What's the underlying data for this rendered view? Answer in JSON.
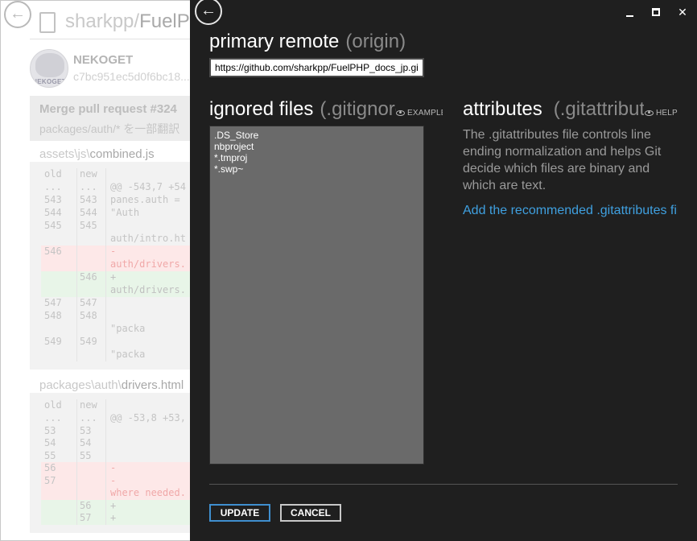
{
  "background": {
    "repo_owner": "sharkpp/",
    "repo_name": "FuelPH",
    "author": "NEKOGET",
    "avatar_tag": "NEKOGET",
    "sha": "c7bc951ec5d0f6bc18...",
    "commit_title": "Merge pull request #324",
    "commit_subtitle": "packages/auth/* を一部翻訳",
    "files": [
      {
        "dir": "assets\\js\\",
        "name": "combined.js",
        "header": [
          "old",
          "new"
        ],
        "hunk": "@@ -543,7 +54",
        "rows": [
          {
            "old": "...",
            "new": "...",
            "text": "@@ -543,7 +54",
            "kind": "hunk"
          },
          {
            "old": "543",
            "new": "543",
            "text": " panes.auth =",
            "kind": "ctx"
          },
          {
            "old": "544",
            "new": "544",
            "text": "      \"Auth",
            "kind": "ctx"
          },
          {
            "old": "545",
            "new": "545",
            "text": "",
            "kind": "ctx"
          },
          {
            "old": "",
            "new": "",
            "text": "auth/intro.ht",
            "kind": "ctx"
          },
          {
            "old": "546",
            "new": "",
            "text": "-",
            "kind": "del"
          },
          {
            "old": "",
            "new": "",
            "text": "auth/drivers.",
            "kind": "del"
          },
          {
            "old": "",
            "new": "546",
            "text": "+",
            "kind": "add"
          },
          {
            "old": "",
            "new": "",
            "text": "auth/drivers.",
            "kind": "add"
          },
          {
            "old": "547",
            "new": "547",
            "text": "",
            "kind": "ctx"
          },
          {
            "old": "548",
            "new": "548",
            "text": "",
            "kind": "ctx"
          },
          {
            "old": "",
            "new": "",
            "text": "      \"packa",
            "kind": "ctx"
          },
          {
            "old": "549",
            "new": "549",
            "text": "",
            "kind": "ctx"
          },
          {
            "old": "",
            "new": "",
            "text": "      \"packa",
            "kind": "ctx"
          }
        ]
      },
      {
        "dir": "packages\\auth\\",
        "name": "drivers.html",
        "header": [
          "old",
          "new"
        ],
        "rows": [
          {
            "old": "...",
            "new": "...",
            "text": "@@ -53,8 +53,",
            "kind": "hunk"
          },
          {
            "old": "53",
            "new": "53",
            "text": "",
            "kind": "ctx"
          },
          {
            "old": "54",
            "new": "54",
            "text": "",
            "kind": "ctx"
          },
          {
            "old": "55",
            "new": "55",
            "text": "",
            "kind": "ctx"
          },
          {
            "old": "56",
            "new": "",
            "text": "-",
            "kind": "del"
          },
          {
            "old": "57",
            "new": "",
            "text": "-",
            "kind": "del"
          },
          {
            "old": "",
            "new": "",
            "text": "where needed.",
            "kind": "del"
          },
          {
            "old": "",
            "new": "56",
            "text": "+",
            "kind": "add"
          },
          {
            "old": "",
            "new": "57",
            "text": "+",
            "kind": "add"
          }
        ]
      }
    ]
  },
  "panel": {
    "back_icon": "back-arrow-icon",
    "window_controls": {
      "minimize": "minimize-icon",
      "maximize": "maximize-icon",
      "close": "close-icon",
      "close_glyph": "✕"
    },
    "remote": {
      "title": "primary remote",
      "subtitle": "(origin)",
      "url": "https://github.com/sharkpp/FuelPHP_docs_jp.git"
    },
    "ignored": {
      "title": "ignored files",
      "subtitle": "(.gitignore)",
      "hint_label": "EXAMPLES",
      "hint_icon": "eye-icon",
      "lines": [
        ".DS_Store",
        "nbproject",
        "*.tmproj",
        "*.swp~"
      ]
    },
    "attributes": {
      "title": "attributes",
      "subtitle": "(.gitattributes)",
      "hint_label": "HELP",
      "hint_icon": "eye-icon",
      "description": "The .gitattributes file controls line ending normalization and helps Git decide which files are binary and which are text.",
      "link": "Add the recommended .gitattributes file"
    },
    "buttons": {
      "update": "UPDATE",
      "cancel": "CANCEL"
    },
    "colors": {
      "panel_bg": "#1f1f1f",
      "accent": "#3f8fcf",
      "link": "#3fa0e0"
    }
  }
}
